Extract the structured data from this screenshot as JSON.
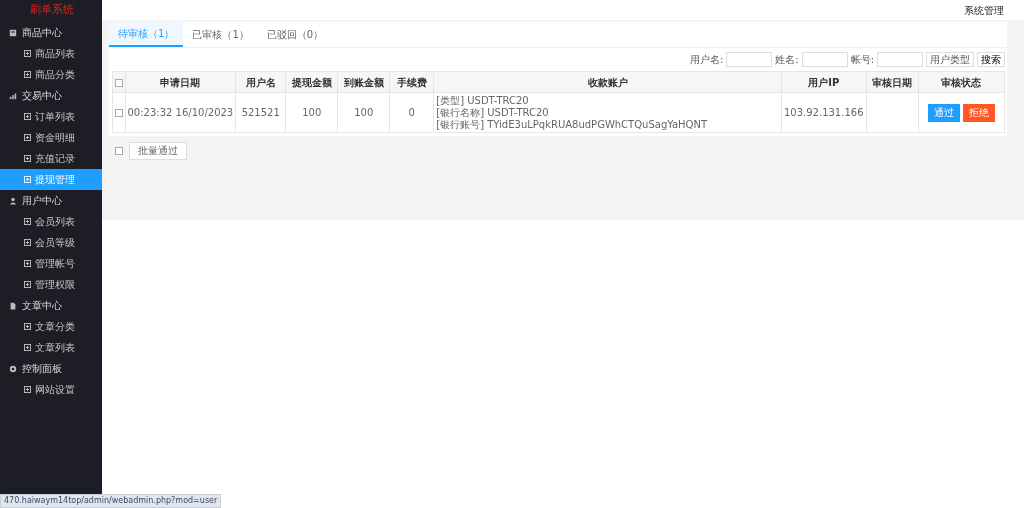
{
  "brand": "刷单系统",
  "header": {
    "title": "系统管理"
  },
  "sidebar": {
    "groups": [
      {
        "label": "商品中心",
        "children": [
          {
            "label": "商品列表",
            "selected": false
          },
          {
            "label": "商品分类",
            "selected": false
          }
        ]
      },
      {
        "label": "交易中心",
        "children": [
          {
            "label": "订单列表",
            "selected": false
          },
          {
            "label": "资金明细",
            "selected": false
          },
          {
            "label": "充值记录",
            "selected": false
          },
          {
            "label": "提现管理",
            "selected": true
          }
        ]
      },
      {
        "label": "用户中心",
        "children": [
          {
            "label": "会员列表",
            "selected": false
          },
          {
            "label": "会员等级",
            "selected": false
          },
          {
            "label": "管理帐号",
            "selected": false
          },
          {
            "label": "管理权限",
            "selected": false
          }
        ]
      },
      {
        "label": "文章中心",
        "children": [
          {
            "label": "文章分类",
            "selected": false
          },
          {
            "label": "文章列表",
            "selected": false
          }
        ]
      },
      {
        "label": "控制面板",
        "children": [
          {
            "label": "网站设置",
            "selected": false
          }
        ]
      }
    ]
  },
  "tabs": [
    {
      "label": "待审核（1）",
      "selected": true
    },
    {
      "label": "已审核（1）",
      "selected": false
    },
    {
      "label": "已驳回（0）",
      "selected": false
    }
  ],
  "filters": {
    "fields": [
      {
        "label": "用户名:"
      },
      {
        "label": "姓名:"
      },
      {
        "label": "帐号:"
      }
    ],
    "select": "用户类型",
    "button": "搜索"
  },
  "table": {
    "all_checked": false,
    "columns": [
      "申请日期",
      "用户名",
      "提现金额",
      "到账金额",
      "手续费",
      "收款账户",
      "用户IP",
      "审核日期",
      "审核状态"
    ],
    "rows": [
      {
        "checked": false,
        "date": "00:23:32 16/10/2023",
        "user": "521521",
        "amount": "100",
        "received": "100",
        "fee": "0",
        "account": [
          "[类型] USDT-TRC20",
          "[银行名称] USDT-TRC20",
          "[银行账号] TYidE3uLPqkRUA8udPGWhCTQuSagYaHQNT"
        ],
        "ip": "103.92.131.166",
        "approve": "通过",
        "reject": "拒绝"
      }
    ]
  },
  "batch": {
    "checked": false,
    "button": "批量通过"
  },
  "status_bar": "470.haiwaym14top/admin/webadmin.php?mod=user"
}
